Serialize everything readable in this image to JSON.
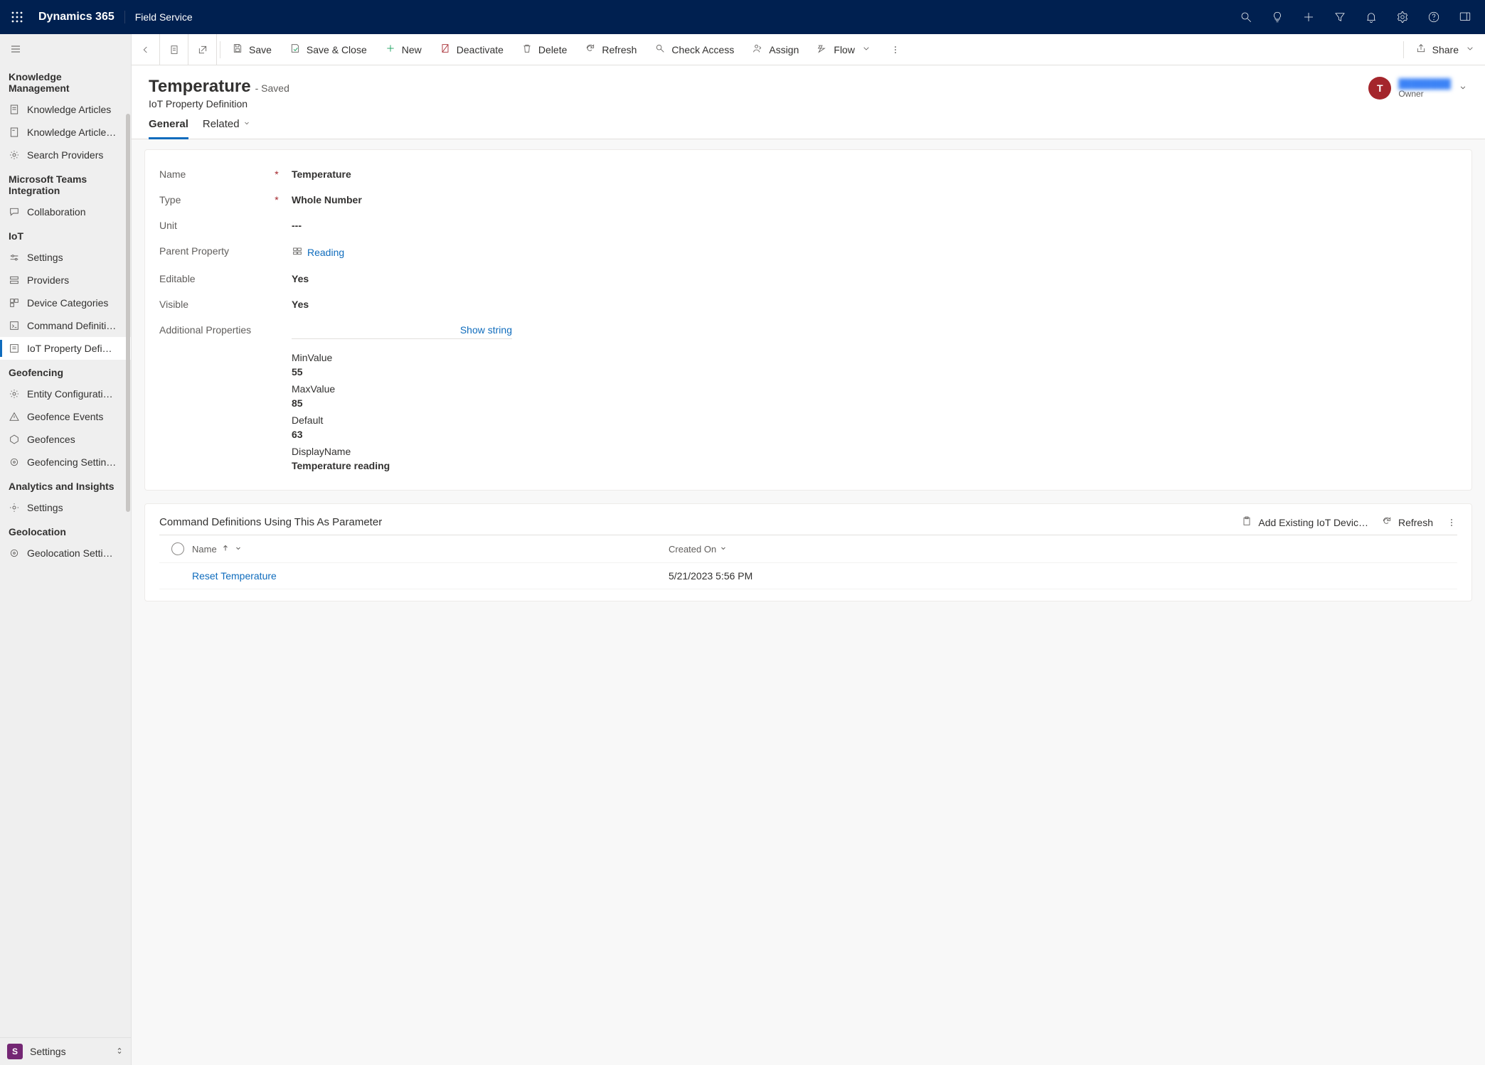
{
  "topbar": {
    "brand": "Dynamics 365",
    "module": "Field Service"
  },
  "commands": {
    "save": "Save",
    "save_close": "Save & Close",
    "new": "New",
    "deactivate": "Deactivate",
    "delete": "Delete",
    "refresh": "Refresh",
    "check_access": "Check Access",
    "assign": "Assign",
    "flow": "Flow",
    "share": "Share"
  },
  "record": {
    "title": "Temperature",
    "saved": "- Saved",
    "entity": "IoT Property Definition",
    "owner_initial": "T",
    "owner_name": "████████",
    "owner_label": "Owner"
  },
  "tabs": {
    "general": "General",
    "related": "Related"
  },
  "fields": {
    "name_label": "Name",
    "name_value": "Temperature",
    "type_label": "Type",
    "type_value": "Whole Number",
    "unit_label": "Unit",
    "unit_value": "---",
    "parent_label": "Parent Property",
    "parent_value": "Reading",
    "editable_label": "Editable",
    "editable_value": "Yes",
    "visible_label": "Visible",
    "visible_value": "Yes",
    "addl_label": "Additional Properties",
    "show_string": "Show string",
    "min_label": "MinValue",
    "min_value": "55",
    "max_label": "MaxValue",
    "max_value": "85",
    "default_label": "Default",
    "default_value": "63",
    "display_label": "DisplayName",
    "display_value": "Temperature reading"
  },
  "subgrid": {
    "title": "Command Definitions Using This As Parameter",
    "add_existing": "Add Existing IoT Devic…",
    "refresh": "Refresh",
    "col_name": "Name",
    "col_created": "Created On",
    "row_name": "Reset Temperature",
    "row_date": "5/21/2023 5:56 PM"
  },
  "sidebar": {
    "groups": [
      {
        "title": "Knowledge Management",
        "items": [
          "Knowledge Articles",
          "Knowledge Article…",
          "Search Providers"
        ]
      },
      {
        "title": "Microsoft Teams Integration",
        "items": [
          "Collaboration"
        ]
      },
      {
        "title": "IoT",
        "items": [
          "Settings",
          "Providers",
          "Device Categories",
          "Command Definiti…",
          "IoT Property Defi…"
        ]
      },
      {
        "title": "Geofencing",
        "items": [
          "Entity Configurati…",
          "Geofence Events",
          "Geofences",
          "Geofencing Settin…"
        ]
      },
      {
        "title": "Analytics and Insights",
        "items": [
          "Settings"
        ]
      },
      {
        "title": "Geolocation",
        "items": [
          "Geolocation Setti…"
        ]
      }
    ],
    "footer_badge": "S",
    "footer_label": "Settings"
  }
}
